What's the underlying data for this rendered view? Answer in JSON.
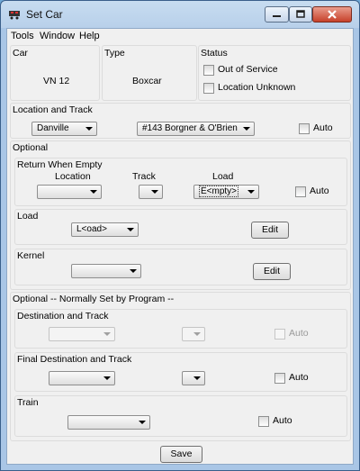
{
  "window": {
    "title": "Set Car"
  },
  "menu": [
    "Tools",
    "Window",
    "Help"
  ],
  "car": {
    "label": "Car",
    "value": "VN 12"
  },
  "type": {
    "label": "Type",
    "value": "Boxcar"
  },
  "status": {
    "label": "Status",
    "out_of_service": "Out of Service",
    "location_unknown": "Location Unknown"
  },
  "location_track": {
    "label": "Location and Track",
    "location": "Danville",
    "track": "#143 Borgner & O'Brien",
    "auto": "Auto"
  },
  "optional": {
    "label": "Optional"
  },
  "return_when_empty": {
    "label": "Return When Empty",
    "col_location": "Location",
    "col_track": "Track",
    "col_load": "Load",
    "load_value": "E<mpty>",
    "auto": "Auto"
  },
  "load": {
    "label": "Load",
    "value": "L<oad>",
    "edit": "Edit"
  },
  "kernel": {
    "label": "Kernel",
    "edit": "Edit"
  },
  "optional_program": {
    "label": "Optional -- Normally Set by Program --"
  },
  "destination": {
    "label": "Destination and Track",
    "auto": "Auto"
  },
  "final_destination": {
    "label": "Final Destination and Track",
    "auto": "Auto"
  },
  "train": {
    "label": "Train",
    "auto": "Auto"
  },
  "save": "Save",
  "icons": {
    "app": "train-car-icon",
    "minimize": "minimize-icon",
    "maximize": "maximize-icon",
    "close": "close-icon"
  },
  "colors": {
    "titlebar": "#b8d0ea",
    "close_button": "#c7412a",
    "client_bg": "#f0f0f0"
  }
}
